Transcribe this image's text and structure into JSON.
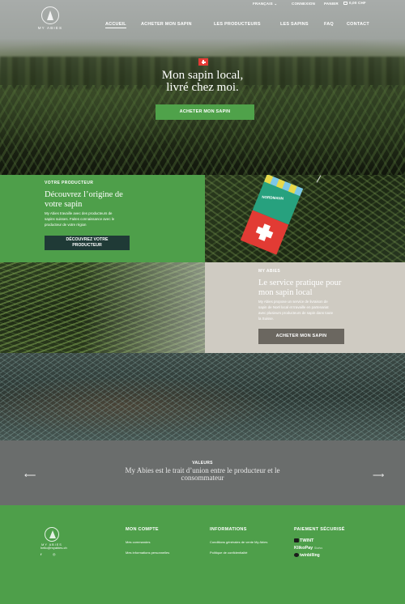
{
  "topbar": {
    "language": "FRANÇAIS",
    "connexion": "CONNEXION",
    "panier": "PANIER",
    "cart_amount": "0,00 CHF"
  },
  "logo": {
    "text": "MY ABIES"
  },
  "nav": {
    "items": [
      {
        "label": "ACCUEIL",
        "active": true
      },
      {
        "label": "ACHETER MON SAPIN",
        "active": false
      },
      {
        "label": "LES PRODUCTEURS",
        "active": false
      },
      {
        "label": "LES SAPINS",
        "active": false
      },
      {
        "label": "FAQ",
        "active": false
      },
      {
        "label": "CONTACT",
        "active": false
      }
    ]
  },
  "hero": {
    "title_line1": "Mon sapin local,",
    "title_line2": "livré chez moi.",
    "cta": "ACHETER MON SAPIN"
  },
  "producer": {
    "eyebrow": "VOTRE PRODUCTEUR",
    "title_line1": "Découvrez l’origine de",
    "title_line2": "votre sapin",
    "text_line1": "My Abies travaille avec des producteurs de",
    "text_line2": "sapins suisses. Faites connaissance avec le",
    "text_line3": "producteur de votre région",
    "cta_line1": "DÉCOUVREZ VOTRE",
    "cta_line2": "PRODUCTEUR",
    "tag_text": "NORDMANN"
  },
  "service": {
    "eyebrow": "MY ABIES",
    "title_line1": "Le service pratique pour",
    "title_line2": "mon sapin local",
    "text_line1": "My Abies propose un service de livraison de",
    "text_line2": "sapin de Noël local et travaille en partenariat",
    "text_line3": "avec plusieurs producteurs de sapin dans toute",
    "text_line4": "la Suisse.",
    "cta": "ACHETER MON SAPIN"
  },
  "values": {
    "label": "VALEURS",
    "text_line1": "My Abies est le trait d’union entre le producteur et le",
    "text_line2": "consommateur",
    "prev": "⟵",
    "next": "⟶"
  },
  "footer": {
    "logo_text": "MY ABIES",
    "email": "hello@myabies.ch",
    "facebook": "f",
    "instagram": "◎",
    "account": {
      "heading": "MON COMPTE",
      "links": [
        "Mes commandes",
        "Mes informations personnelles"
      ]
    },
    "info": {
      "heading": "INFORMATIONS",
      "links": [
        "Conditions générales de vente My Abies",
        "Politique de confidentialité"
      ]
    },
    "payment": {
      "heading": "PAIEMENT SÉCURISÉ",
      "methods": [
        "TWINT",
        "KlikoPay",
        "twinbilling"
      ],
      "kliko_suffix": "Swiss"
    }
  },
  "colors": {
    "green": "#4e9f4a",
    "dark_teal": "#1f3a36",
    "grey_beige": "#cfcbc2",
    "values_grey": "#6a6d6c"
  }
}
